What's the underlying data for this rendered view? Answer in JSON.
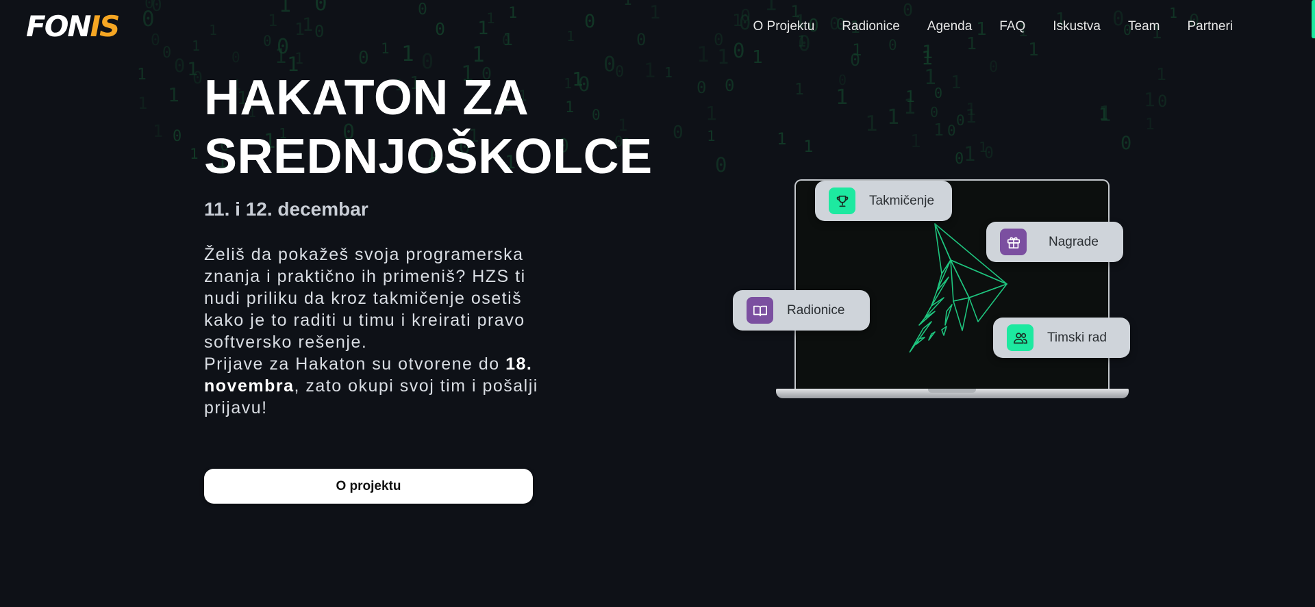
{
  "logo": {
    "part1": "FON",
    "part2": "IS"
  },
  "nav": {
    "items": [
      "O Projektu",
      "Radionice",
      "Agenda",
      "FAQ",
      "Iskustva",
      "Team",
      "Partneri"
    ]
  },
  "hero": {
    "title_line1": "HAKATON ZA",
    "title_line2": "SREDNJOŠKOLCE",
    "date": "11. i 12. decembar",
    "paragraph1": "Želiš da pokažeš svoja programerska znanja i praktično ih primeniš? HZS ti nudi priliku da kroz takmičenje osetiš kako je to raditi u timu i kreirati pravo softversko rešenje.",
    "paragraph2_before": "Prijave za Hakaton su otvorene do ",
    "paragraph2_bold": "18. novembra",
    "paragraph2_after": ", zato okupi svoj tim i pošalji prijavu!",
    "cta_label": "O projektu"
  },
  "illustration": {
    "chips": [
      {
        "label": "Takmičenje",
        "icon": "trophy-icon",
        "color": "#1de9a0"
      },
      {
        "label": "Nagrade",
        "icon": "gift-icon",
        "color": "#7b4fa0"
      },
      {
        "label": "Radionice",
        "icon": "book-icon",
        "color": "#7b4fa0"
      },
      {
        "label": "Timski rad",
        "icon": "team-icon",
        "color": "#1de9a0"
      }
    ]
  },
  "colors": {
    "background": "#0e1117",
    "accent_green": "#1de9a0",
    "accent_purple": "#7b4fa0",
    "logo_orange": "#f5a623"
  }
}
